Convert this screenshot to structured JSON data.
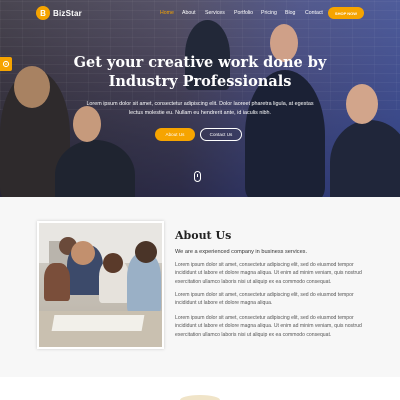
{
  "brand": {
    "name": "BizStar",
    "logo_letter": "B",
    "accent_color": "#f6a400"
  },
  "nav": {
    "items": [
      {
        "label": "Home",
        "active": true
      },
      {
        "label": "About",
        "active": false
      },
      {
        "label": "Services",
        "active": false
      },
      {
        "label": "Portfolio",
        "active": false
      },
      {
        "label": "Pricing",
        "active": false
      },
      {
        "label": "Blog",
        "active": false
      },
      {
        "label": "Contact",
        "active": false
      }
    ],
    "cta_label": "SHOP NOW"
  },
  "side_tab": {
    "icon": "gear-icon"
  },
  "hero": {
    "title_line1": "Get your creative work done by",
    "title_line2": "Industry Professionals",
    "subtitle": "Lorem ipsum dolor sit amet, consectetur adipiscing elit. Dolor laoreet pharetra ligula, at egestas lectus molestie eu. Nullam eu hendrerit ante, id iaculis nibh.",
    "primary_button": "About Us",
    "secondary_button": "Contact Us",
    "scroll_icon": "mouse-scroll-icon"
  },
  "about": {
    "title": "About Us",
    "lead": "We are a experienced company in business services.",
    "paragraphs": [
      "Lorem ipsum dolor sit amet, consectetur adipiscing elit, sed do eiusmod tempor incididunt ut labore et dolore magna aliqua. Ut enim ad minim veniam, quis nostrud exercitation ullamco laboris nisi ut aliquip ex ea commodo consequat.",
      "Lorem ipsum dolor sit amet, consectetur adipiscing elit, sed do eiusmod tempor incididunt ut labore et dolore magna aliqua.",
      "Lorem ipsum dolor sit amet, consectetur adipiscing elit, sed do eiusmod tempor incididunt ut labore et dolore magna aliqua. Ut enim ad minim veniam, quis nostrud exercitation ullamco laboris nisi ut aliquip ex ea commodo consequat."
    ]
  }
}
